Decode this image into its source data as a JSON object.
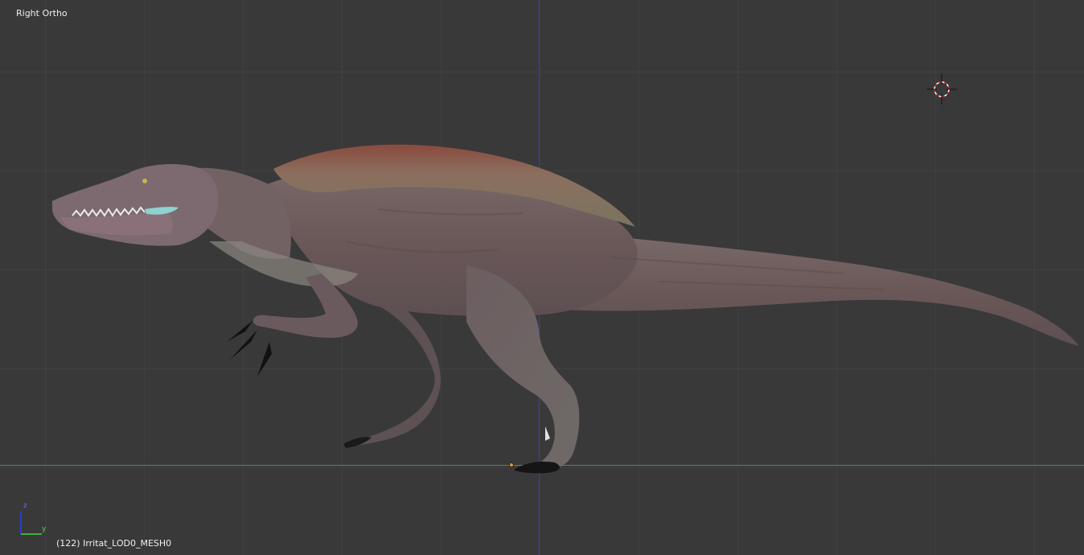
{
  "viewport": {
    "view_name": "Right Ortho",
    "object_info": "(122) Irritat_LOD0_MESH0"
  },
  "gizmo": {
    "z_label": "z",
    "y_label": "y"
  },
  "colors": {
    "background": "#393939",
    "z_axis": "#2a3ec6",
    "y_axis": "#3d9a3d",
    "object_origin": "#e8943a",
    "cursor_red": "#d81e1e",
    "text": "#f0f0f0"
  },
  "icons": {
    "cursor": "3d-cursor-icon",
    "gizmo": "axis-gizmo-icon",
    "origin": "object-origin-icon"
  }
}
